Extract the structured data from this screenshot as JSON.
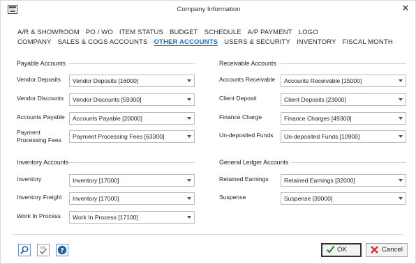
{
  "window": {
    "title": "Company Information"
  },
  "tabs": {
    "row1": [
      "A/R & SHOWROOM",
      "PO / WO",
      "ITEM STATUS",
      "BUDGET",
      "SCHEDULE",
      "A/P PAYMENT",
      "LOGO"
    ],
    "row2": [
      "COMPANY",
      "SALES & COGS ACCOUNTS",
      "OTHER ACCOUNTS",
      "USERS & SECURITY",
      "INVENTORY",
      "FISCAL MONTH"
    ],
    "active": "OTHER ACCOUNTS"
  },
  "payable": {
    "title": "Payable Accounts",
    "vendor_deposits": {
      "label": "Vendor Deposits",
      "value": "Vendor Deposits [16000]"
    },
    "vendor_discounts": {
      "label": "Vendor Discounts",
      "value": "Vendor Discounts [59300]"
    },
    "accounts_payable": {
      "label": "Accounts Payable",
      "value": "Accounts Payable [20000]"
    },
    "payment_processing": {
      "label_line1": "Payment",
      "label_line2": "Processing Fees",
      "value": "Payment Processing Fees [63300]"
    }
  },
  "receivable": {
    "title": "Receivable Accounts",
    "accounts_receivable": {
      "label": "Accounts Receivable",
      "value": "Accounts Receivable [15000]"
    },
    "client_deposit": {
      "label": "Client Deposit",
      "value": "Client Deposits [23000]"
    },
    "finance_charge": {
      "label": "Finance Charge",
      "value": "Finance Charges [49300]"
    },
    "undeposited_funds": {
      "label": "Un-deposited Funds",
      "value": "Un-deposited Funds [10900]"
    }
  },
  "inventory": {
    "title": "Inventory Accounts",
    "inventory": {
      "label": "Inventory",
      "value": "Inventory [17000]"
    },
    "inventory_freight": {
      "label": "Inventory Freight",
      "value": "Inventory [17000]"
    },
    "work_in_process": {
      "label": "Work In Process",
      "value": "Work In Process [17100]"
    }
  },
  "general_ledger": {
    "title": "General Ledger Accounts",
    "retained_earnings": {
      "label": "Retained Earnings",
      "value": "Retained Earnings [32000]"
    },
    "suspense": {
      "label": "Suspense",
      "value": "Suspense [39000]"
    }
  },
  "buttons": {
    "ok": "OK",
    "cancel": "Cancel"
  },
  "icons": {
    "app": "window-icon",
    "close": "close-icon",
    "search": "search-icon",
    "spellcheck": "spellcheck-icon",
    "help": "help-icon",
    "ok": "checkmark-icon",
    "cancel": "cancel-icon"
  },
  "colors": {
    "active_tab": "#1f6fb5",
    "ok_check": "#2e8b2e",
    "cancel_x": "#d0312d",
    "icon_blue": "#1f5fa8"
  }
}
